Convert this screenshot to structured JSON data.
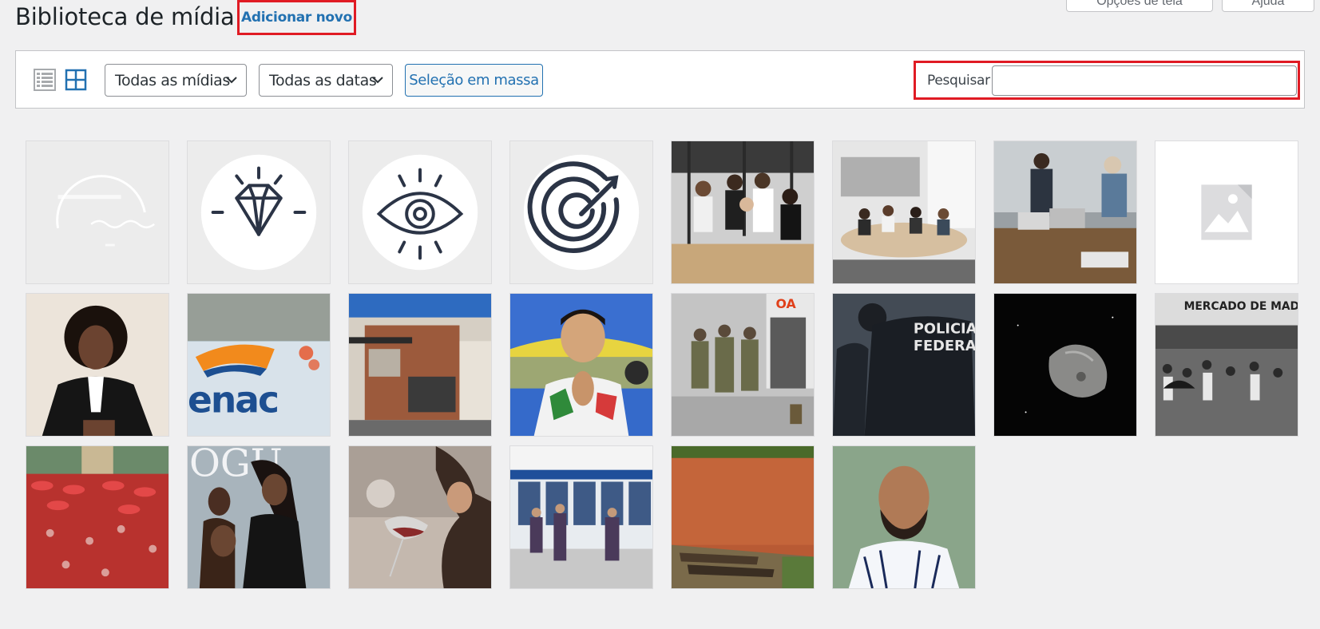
{
  "header": {
    "title": "Biblioteca de mídia",
    "add_new": "Adicionar novo",
    "screen_options": "Opções de tela",
    "help": "Ajuda"
  },
  "toolbar": {
    "view_list_icon": "list-view-icon",
    "view_grid_icon": "grid-view-icon",
    "filter_media": "Todas as mídias",
    "filter_dates": "Todas as datas",
    "bulk_select": "Seleção em massa",
    "search_label": "Pesquisar",
    "search_value": ""
  },
  "media": [
    {
      "kind": "logo-signature",
      "name": "media-item-logo"
    },
    {
      "kind": "icon-diamond",
      "name": "media-item-diamond-icon"
    },
    {
      "kind": "icon-eye",
      "name": "media-item-eye-icon"
    },
    {
      "kind": "icon-target",
      "name": "media-item-target-icon"
    },
    {
      "kind": "photo-team-highfive",
      "name": "media-item-team-highfive"
    },
    {
      "kind": "photo-meeting-room",
      "name": "media-item-meeting-room"
    },
    {
      "kind": "photo-office-presentation",
      "name": "media-item-office-presentation"
    },
    {
      "kind": "placeholder",
      "name": "media-item-placeholder"
    },
    {
      "kind": "photo-portrait-woman",
      "name": "media-item-portrait-woman"
    },
    {
      "kind": "photo-enac-card",
      "name": "media-item-enac-card"
    },
    {
      "kind": "photo-brick-house",
      "name": "media-item-brick-house"
    },
    {
      "kind": "photo-boy-praying",
      "name": "media-item-boy-praying"
    },
    {
      "kind": "photo-soldiers",
      "name": "media-item-soldiers"
    },
    {
      "kind": "photo-policia-federal",
      "name": "media-item-policia-federal"
    },
    {
      "kind": "photo-asteroid",
      "name": "media-item-asteroid"
    },
    {
      "kind": "photo-mercado-madureira",
      "name": "media-item-mercado-madureira"
    },
    {
      "kind": "photo-carnival-crowd",
      "name": "media-item-carnival-crowd"
    },
    {
      "kind": "photo-vogue-cover",
      "name": "media-item-vogue-cover"
    },
    {
      "kind": "photo-wine-glass",
      "name": "media-item-wine-glass"
    },
    {
      "kind": "photo-atm-bank",
      "name": "media-item-atm-bank"
    },
    {
      "kind": "photo-red-river",
      "name": "media-item-red-river"
    },
    {
      "kind": "photo-football-player",
      "name": "media-item-football-player"
    }
  ],
  "image_text": {
    "enac_logo": "enac",
    "policia": "POLICIA",
    "federal": "FEDERAL",
    "mercado": "MERCADO DE MADURE",
    "vogue": "OGU",
    "bank_sign": "OA"
  },
  "colors": {
    "accent": "#2271b1",
    "highlight": "#e01b24",
    "background": "#f0f0f1"
  }
}
